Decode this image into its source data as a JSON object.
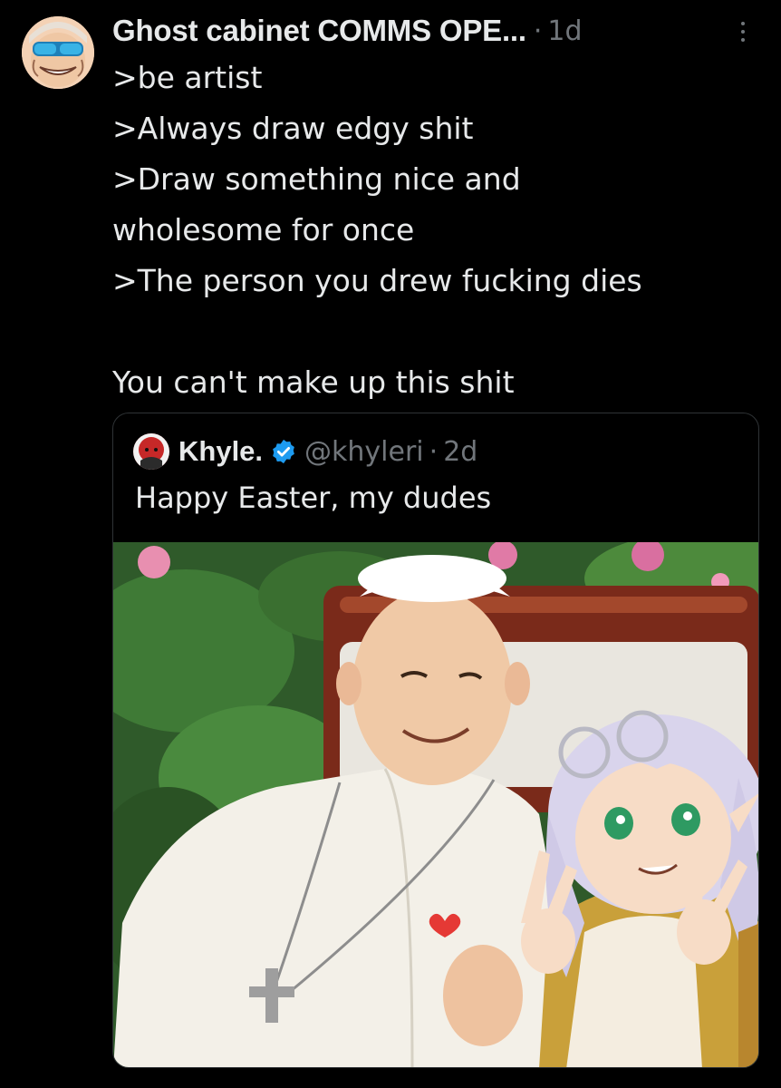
{
  "post": {
    "author_name": "Ghost cabinet COMMS OPE...",
    "separator": "·",
    "time": "1d",
    "lines": [
      ">be artist",
      ">Always draw edgy shit",
      ">Draw something nice and",
      "wholesome for once",
      ">The person you drew fucking dies",
      "",
      "You can't make up this shit"
    ]
  },
  "quote": {
    "author_name": "Khyle.",
    "handle": "@khyleri",
    "separator": "·",
    "time": "2d",
    "text": "Happy Easter, my dudes"
  },
  "icons": {
    "more": "more-dots-icon",
    "verified": "verified-badge-icon"
  },
  "colors": {
    "background": "#000000",
    "text": "#e7e9ea",
    "muted": "#71767b",
    "border": "#2f3336",
    "verified": "#1d9bf0"
  }
}
